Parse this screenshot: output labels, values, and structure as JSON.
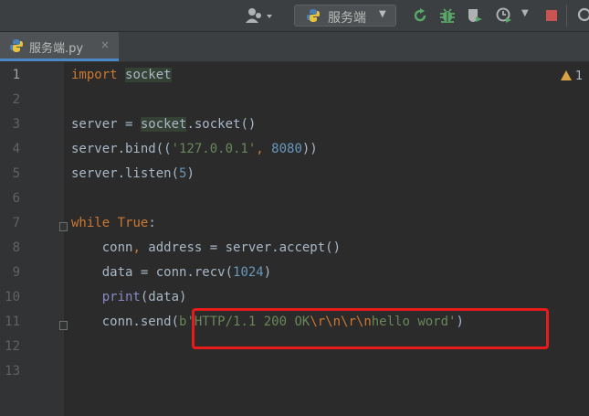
{
  "toolbar": {
    "run_config_label": "服务端",
    "icons": [
      "user-icon",
      "python-icon",
      "rerun-icon",
      "debug-icon",
      "coverage-icon",
      "profile-icon",
      "stop-icon"
    ]
  },
  "tab": {
    "filename": "服务端.py",
    "close": "×"
  },
  "inspection": {
    "warning_count": "1"
  },
  "editor": {
    "line_numbers": [
      "1",
      "2",
      "3",
      "4",
      "5",
      "6",
      "7",
      "8",
      "9",
      "10",
      "11",
      "12",
      "13"
    ],
    "lines": [
      {
        "tokens": [
          {
            "t": "import",
            "c": "kw"
          },
          {
            "t": " ",
            "c": ""
          },
          {
            "t": "socket",
            "c": "hl"
          }
        ]
      },
      {
        "tokens": []
      },
      {
        "tokens": [
          {
            "t": "server = ",
            "c": ""
          },
          {
            "t": "socket",
            "c": "hl"
          },
          {
            "t": ".socket()",
            "c": ""
          }
        ]
      },
      {
        "tokens": [
          {
            "t": "server.bind((",
            "c": ""
          },
          {
            "t": "'127.0.0.1'",
            "c": "str"
          },
          {
            "t": ", ",
            "c": "kw"
          },
          {
            "t": "8080",
            "c": "num"
          },
          {
            "t": "))",
            "c": ""
          }
        ]
      },
      {
        "tokens": [
          {
            "t": "server.listen(",
            "c": ""
          },
          {
            "t": "5",
            "c": "num"
          },
          {
            "t": ")",
            "c": ""
          }
        ]
      },
      {
        "tokens": []
      },
      {
        "tokens": [
          {
            "t": "while",
            "c": "kw"
          },
          {
            "t": " ",
            "c": ""
          },
          {
            "t": "True",
            "c": "kw"
          },
          {
            "t": ":",
            "c": ""
          }
        ]
      },
      {
        "tokens": [
          {
            "t": "    conn",
            "c": ""
          },
          {
            "t": ",",
            "c": "kw"
          },
          {
            "t": " address = server.accept()",
            "c": ""
          }
        ]
      },
      {
        "tokens": [
          {
            "t": "    data = conn.recv(",
            "c": ""
          },
          {
            "t": "1024",
            "c": "num"
          },
          {
            "t": ")",
            "c": ""
          }
        ]
      },
      {
        "tokens": [
          {
            "t": "    ",
            "c": ""
          },
          {
            "t": "print",
            "c": "bi"
          },
          {
            "t": "(data)",
            "c": ""
          }
        ]
      },
      {
        "tokens": [
          {
            "t": "    conn.send(",
            "c": ""
          },
          {
            "t": "b'HTTP/1.1 200 OK",
            "c": "str"
          },
          {
            "t": "\\r\\n\\r\\n",
            "c": "esc"
          },
          {
            "t": "hello word'",
            "c": "str"
          },
          {
            "t": ")",
            "c": ""
          }
        ]
      },
      {
        "tokens": []
      },
      {
        "tokens": []
      }
    ]
  },
  "annotation": {
    "color": "#e81b1b"
  }
}
